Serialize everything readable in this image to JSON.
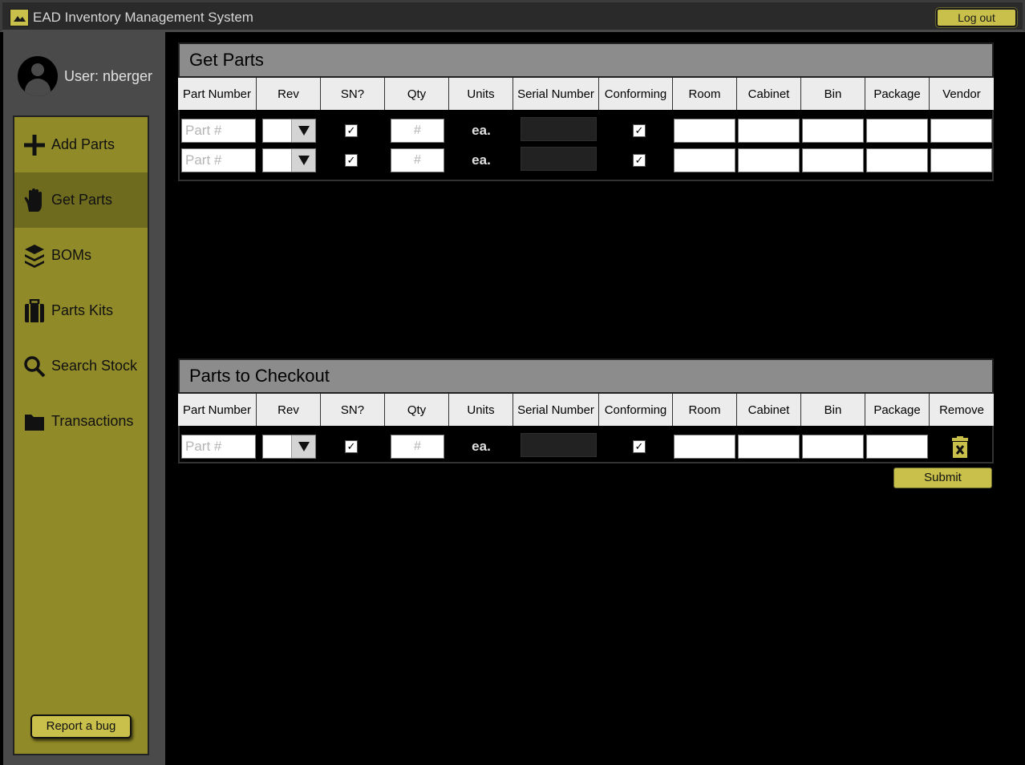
{
  "app": {
    "title": "EAD Inventory Management System",
    "logout_label": "Log out"
  },
  "user": {
    "label": "User: nberger"
  },
  "nav": {
    "items": [
      {
        "label": "Add Parts",
        "icon": "plus-icon"
      },
      {
        "label": "Get Parts",
        "icon": "hand-icon",
        "active": true
      },
      {
        "label": "BOMs",
        "icon": "layers-icon"
      },
      {
        "label": "Parts Kits",
        "icon": "suitcase-icon"
      },
      {
        "label": "Search Stock",
        "icon": "search-icon"
      },
      {
        "label": "Transactions",
        "icon": "folder-icon"
      }
    ],
    "report_bug_label": "Report a bug"
  },
  "get_parts": {
    "title": "Get Parts",
    "columns": [
      "Part Number",
      "Rev",
      "SN?",
      "Qty",
      "Units",
      "Serial Number",
      "Conforming",
      "Room",
      "Cabinet",
      "Bin",
      "Package",
      "Vendor"
    ],
    "rows": [
      {
        "part_placeholder": "Part #",
        "qty_placeholder": "#",
        "units": "ea.",
        "sn_checked": "✓",
        "conforming_checked": "✓"
      },
      {
        "part_placeholder": "Part #",
        "qty_placeholder": "#",
        "units": "ea.",
        "sn_checked": "✓",
        "conforming_checked": "✓"
      }
    ]
  },
  "checkout": {
    "title": "Parts to Checkout",
    "columns": [
      "Part Number",
      "Rev",
      "SN?",
      "Qty",
      "Units",
      "Serial Number",
      "Conforming",
      "Room",
      "Cabinet",
      "Bin",
      "Package",
      "Remove"
    ],
    "rows": [
      {
        "part_placeholder": "Part #",
        "qty_placeholder": "#",
        "units": "ea.",
        "sn_checked": "✓",
        "conforming_checked": "✓"
      }
    ],
    "submit_label": "Submit"
  },
  "colors": {
    "accent": "#c8c04a",
    "sidebar": "#908a28",
    "sidebar_active": "#6e6a1e",
    "panel_header": "#8c8c8c"
  }
}
